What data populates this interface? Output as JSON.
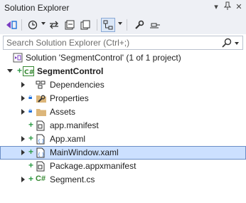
{
  "window": {
    "title": "Solution Explorer"
  },
  "toolbar": {
    "buttons": [
      {
        "name": "switch-views-icon"
      },
      {
        "name": "history-icon"
      },
      {
        "name": "sync-icon"
      },
      {
        "name": "collapse-all-icon"
      },
      {
        "name": "show-all-files-icon"
      },
      {
        "name": "preview-selected-icon"
      },
      {
        "name": "properties-wrench-icon"
      },
      {
        "name": "pin-icon"
      }
    ]
  },
  "search": {
    "placeholder": "Search Solution Explorer (Ctrl+;)"
  },
  "tree": {
    "solution": {
      "label": "Solution 'SegmentControl' (1 of 1 project)"
    },
    "project": {
      "label": "SegmentControl"
    },
    "items": [
      {
        "label": "Dependencies"
      },
      {
        "label": "Properties"
      },
      {
        "label": "Assets"
      },
      {
        "label": "app.manifest"
      },
      {
        "label": "App.xaml"
      },
      {
        "label": "MainWindow.xaml"
      },
      {
        "label": "Package.appxmanifest"
      },
      {
        "label": "Segment.cs"
      }
    ],
    "selected": "MainWindow.xaml"
  },
  "colors": {
    "accent": "#1e6fd9",
    "selection": "#cce0ff",
    "added": "#2e9b47",
    "folder": "#dcb67a",
    "csharp": "#368832"
  }
}
